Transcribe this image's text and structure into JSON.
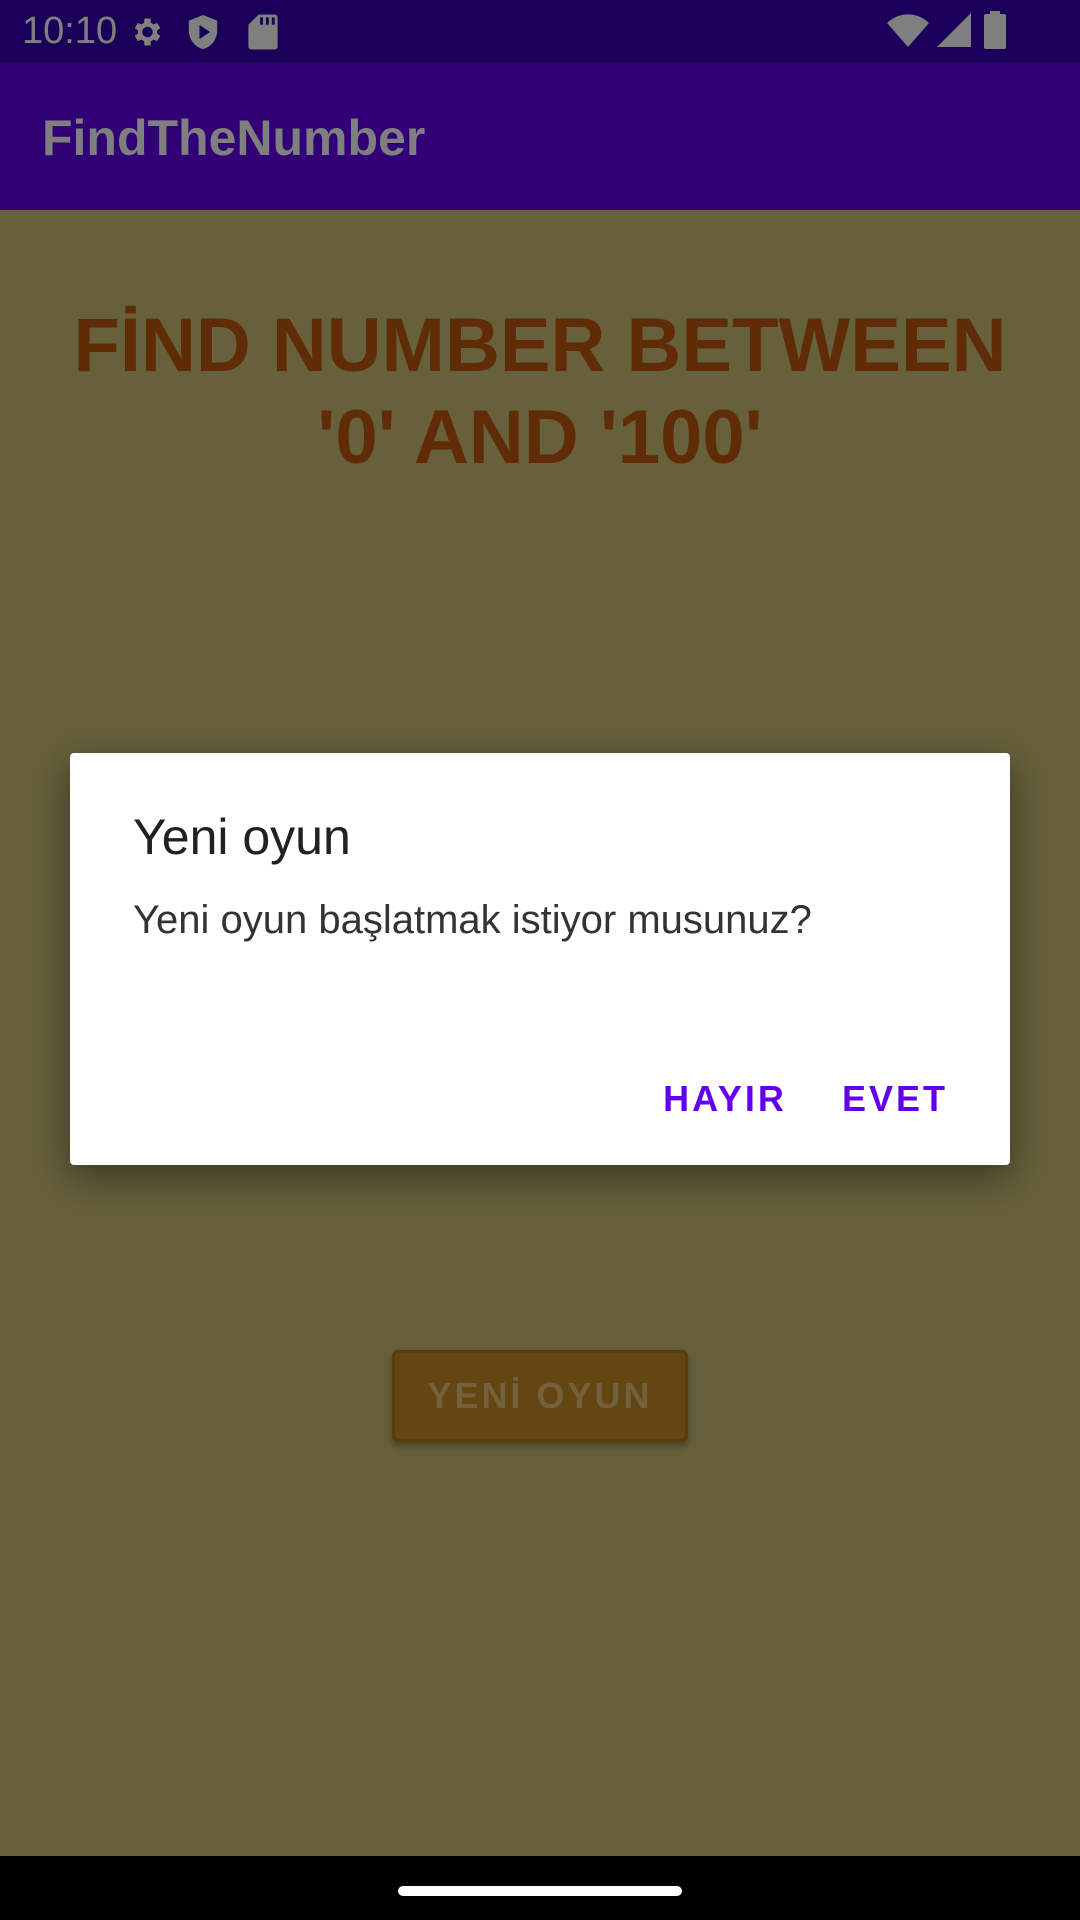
{
  "status_bar": {
    "time": "10:10",
    "left_icons": [
      "gear-icon",
      "shield-icon",
      "sd-card-icon"
    ],
    "right_icons": [
      "wifi-icon",
      "signal-icon",
      "battery-icon"
    ]
  },
  "app_bar": {
    "title": "FindTheNumber"
  },
  "content": {
    "headline_line1": "FİND NUMBER BETWEEN",
    "headline_line2": "'0' AND '100'",
    "new_game_button": "YENİ OYUN"
  },
  "dialog": {
    "title": "Yeni oyun",
    "message": "Yeni oyun başlatmak istiyor musunuz?",
    "negative_button": "HAYIR",
    "positive_button": "EVET"
  },
  "colors": {
    "primary": "#6200ee",
    "primary_dark": "#3700b3",
    "content_background": "#ccc276",
    "headline_color": "#c0560e",
    "button_background": "#c98c27"
  }
}
